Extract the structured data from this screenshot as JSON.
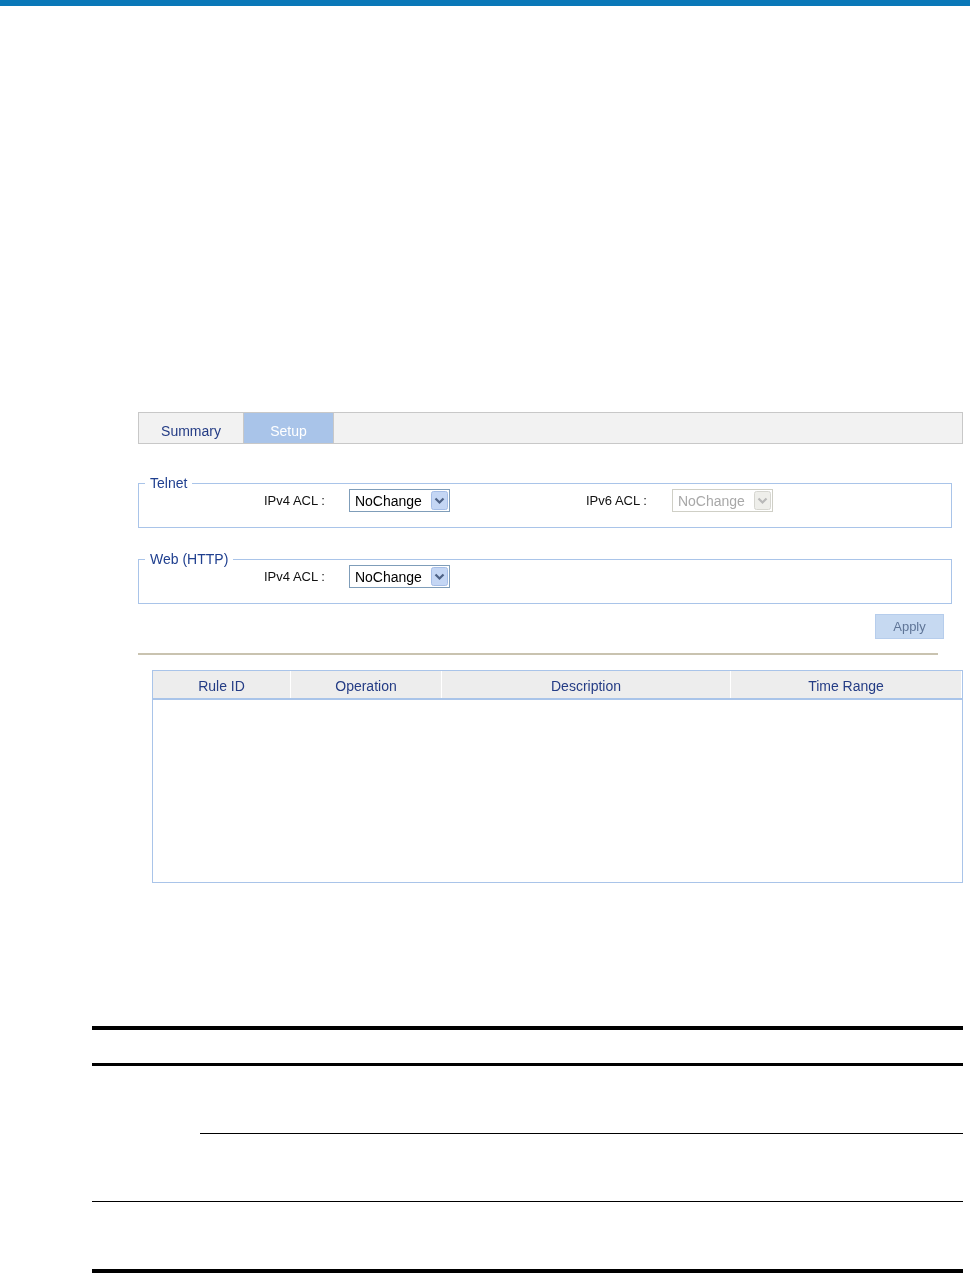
{
  "tabs": [
    {
      "label": "Summary",
      "selected": false
    },
    {
      "label": "Setup",
      "selected": true
    }
  ],
  "groups": [
    {
      "title": "Telnet",
      "fields": [
        {
          "label": "IPv4 ACL :",
          "value": "NoChange",
          "disabled": false
        },
        {
          "label": "IPv6 ACL :",
          "value": "NoChange",
          "disabled": true
        }
      ]
    },
    {
      "title": "Web (HTTP)",
      "fields": [
        {
          "label": "IPv4 ACL :",
          "value": "NoChange",
          "disabled": false
        }
      ]
    }
  ],
  "apply_button": {
    "label": "Apply",
    "disabled": true
  },
  "table": {
    "columns": [
      "Rule ID",
      "Operation",
      "Description",
      "Time Range"
    ]
  }
}
